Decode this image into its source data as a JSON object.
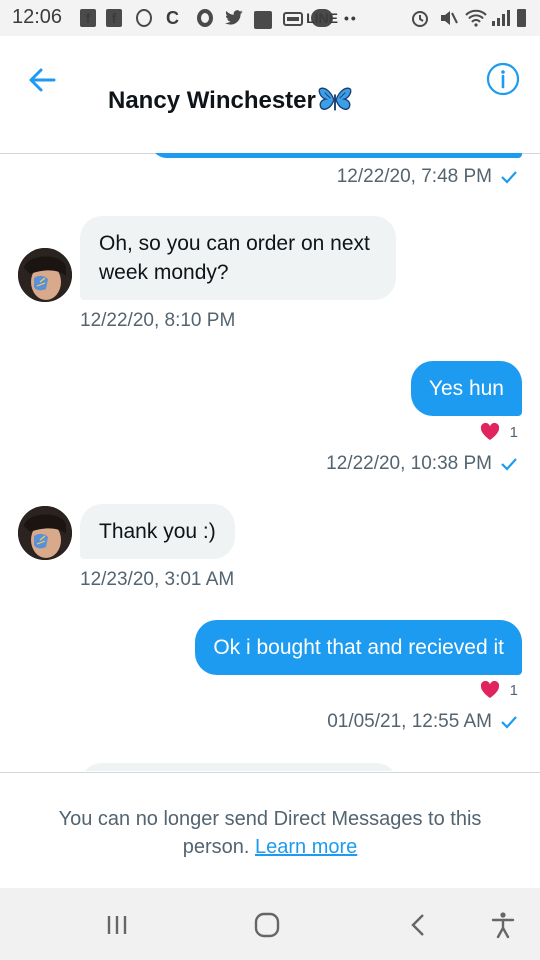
{
  "status_bar": {
    "time": "12:06",
    "icons": [
      "facebook-icon",
      "facebook-icon",
      "whatsapp-icon",
      "c-icon",
      "chrome-icon",
      "twitter-icon",
      "folder-icon",
      "amazon-icon",
      "line-icon",
      "more-dots-icon",
      "alarm-icon",
      "mute-icon",
      "wifi-icon",
      "signal-icon",
      "battery-icon"
    ],
    "facebook_glyph": "f",
    "line_label": "LINE"
  },
  "header": {
    "contact_name": "Nancy Winchester",
    "contact_emoji": "butterfly-icon",
    "back_icon": "back-arrow-icon",
    "info_icon": "info-icon"
  },
  "messages": [
    {
      "direction": "out",
      "text": "",
      "timestamp": "12/22/20, 7:48 PM",
      "read": true,
      "partial": true
    },
    {
      "direction": "in",
      "text": "Oh, so you can order on next week mondy?",
      "line1": "Oh, so you can order on next",
      "line2": "week mondy?",
      "timestamp": "12/22/20, 8:10 PM"
    },
    {
      "direction": "out",
      "text": "Yes hun",
      "likes": "1",
      "timestamp": "12/22/20, 10:38 PM",
      "read": true
    },
    {
      "direction": "in",
      "text": "Thank you :)",
      "timestamp": "12/23/20, 3:01 AM"
    },
    {
      "direction": "out",
      "text": "Ok i bought that and recieved it",
      "likes": "1",
      "timestamp": "01/05/21, 12:55 AM",
      "read": true
    }
  ],
  "footer": {
    "notice_text": "You can no longer send Direct Messages to this person.",
    "link_text": "Learn more"
  },
  "colors": {
    "accent": "#1d9bf0",
    "incoming_bubble": "#eff3f4",
    "like_heart": "#f91880",
    "muted_text": "#536471"
  },
  "nav_bar": {
    "buttons": [
      "recent-apps-icon",
      "home-icon",
      "back-icon",
      "accessibility-icon"
    ]
  }
}
